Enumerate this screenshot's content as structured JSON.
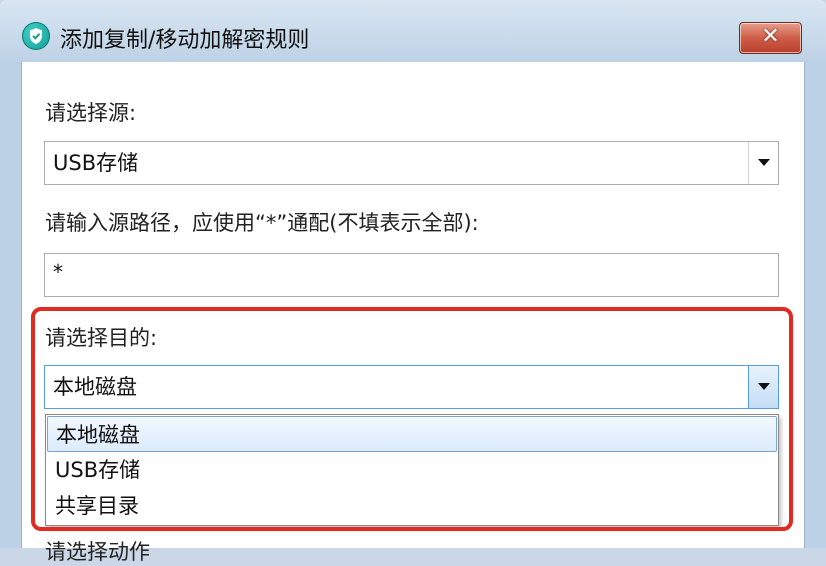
{
  "window": {
    "title": "添加复制/移动加解密规则",
    "close_label": "✕"
  },
  "source": {
    "label": "请选择源:",
    "selected": "USB存储"
  },
  "path": {
    "label": "请输入源路径，应使用“*”通配(不填表示全部):",
    "value": "*"
  },
  "destination": {
    "label": "请选择目的:",
    "selected": "本地磁盘",
    "options": [
      "本地磁盘",
      "USB存储",
      "共享目录"
    ]
  },
  "next_label_partial": "请选择动作",
  "colors": {
    "highlight": "#e02a22",
    "titlebar": "#c6d8ea",
    "close_button": "#cf5d47"
  },
  "icons": {
    "app": "shield-check-icon",
    "close": "close-icon",
    "dropdown": "chevron-down-icon"
  }
}
